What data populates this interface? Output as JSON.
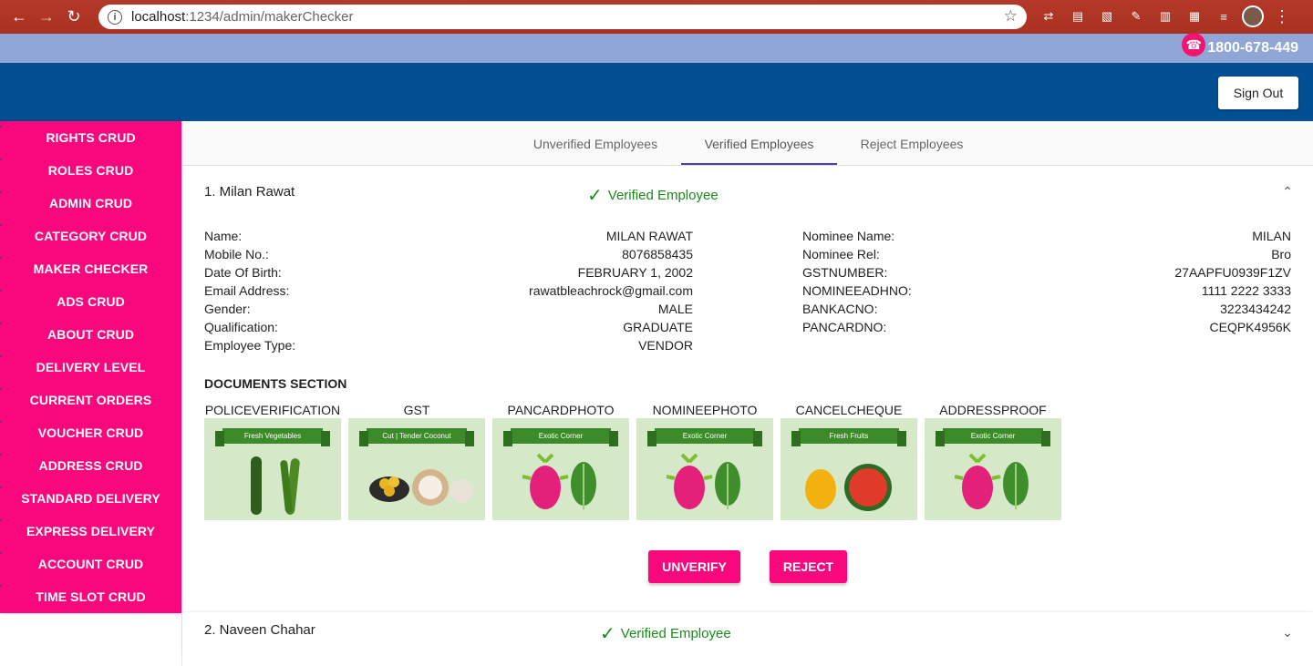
{
  "browser": {
    "url_host": "localhost",
    "url_path": ":1234/admin/makerChecker"
  },
  "top_strip": {
    "phone": "1800-678-449"
  },
  "header": {
    "signout_label": "Sign Out"
  },
  "sidebar": {
    "items": [
      {
        "label": "RIGHTS CRUD"
      },
      {
        "label": "ROLES CRUD"
      },
      {
        "label": "ADMIN CRUD"
      },
      {
        "label": "CATEGORY CRUD"
      },
      {
        "label": "MAKER CHECKER"
      },
      {
        "label": "ADS CRUD"
      },
      {
        "label": "ABOUT CRUD"
      },
      {
        "label": "DELIVERY LEVEL"
      },
      {
        "label": "CURRENT ORDERS"
      },
      {
        "label": "VOUCHER CRUD"
      },
      {
        "label": "ADDRESS CRUD"
      },
      {
        "label": "STANDARD DELIVERY"
      },
      {
        "label": "EXPRESS DELIVERY"
      },
      {
        "label": "ACCOUNT CRUD"
      },
      {
        "label": "TIME SLOT CRUD"
      }
    ]
  },
  "tabs": [
    {
      "label": "Unverified Employees"
    },
    {
      "label": "Verified Employees"
    },
    {
      "label": "Reject Employees"
    }
  ],
  "employees": [
    {
      "title": "1. Milan Rawat",
      "status": "Verified Employee",
      "left": [
        {
          "label": "Name:",
          "value": "MILAN RAWAT"
        },
        {
          "label": "Mobile No.:",
          "value": "8076858435"
        },
        {
          "label": "Date Of Birth:",
          "value": "FEBRUARY 1, 2002"
        },
        {
          "label": "Email Address:",
          "value": "rawatbleachrock@gmail.com"
        },
        {
          "label": "Gender:",
          "value": "MALE"
        },
        {
          "label": "Qualification:",
          "value": "GRADUATE"
        },
        {
          "label": "Employee Type:",
          "value": "VENDOR"
        }
      ],
      "right": [
        {
          "label": "Nominee Name:",
          "value": "MILAN"
        },
        {
          "label": "Nominee Rel:",
          "value": "Bro"
        },
        {
          "label": "GSTNUMBER:",
          "value": "27AAPFU0939F1ZV"
        },
        {
          "label": "NOMINEEADHNO:",
          "value": "1111 2222 3333"
        },
        {
          "label": "BANKACNO:",
          "value": "3223434242"
        },
        {
          "label": "PANCARDNO:",
          "value": "CEQPK4956K"
        }
      ],
      "docs_title": "DOCUMENTS SECTION",
      "documents": [
        {
          "label": "POLICEVERIFICATION",
          "banner": "Fresh Vegetables"
        },
        {
          "label": "GST",
          "banner": "Cut | Tender Coconut"
        },
        {
          "label": "PANCARDPHOTO",
          "banner": "Exotic Corner"
        },
        {
          "label": "NOMINEEPHOTO",
          "banner": "Exotic Corner"
        },
        {
          "label": "CANCELCHEQUE",
          "banner": "Fresh Fruits"
        },
        {
          "label": "ADDRESSPROOF",
          "banner": "Exotic Corner"
        }
      ],
      "actions": {
        "unverify": "UNVERIFY",
        "reject": "REJECT"
      }
    },
    {
      "title": "2. Naveen Chahar",
      "status": "Verified Employee"
    }
  ],
  "colors": {
    "sidebar": "#f8087c",
    "header": "#024f93",
    "strip": "#8fa6d6",
    "verified": "#1a8a1a",
    "tab_indicator": "#4a3fb0"
  }
}
